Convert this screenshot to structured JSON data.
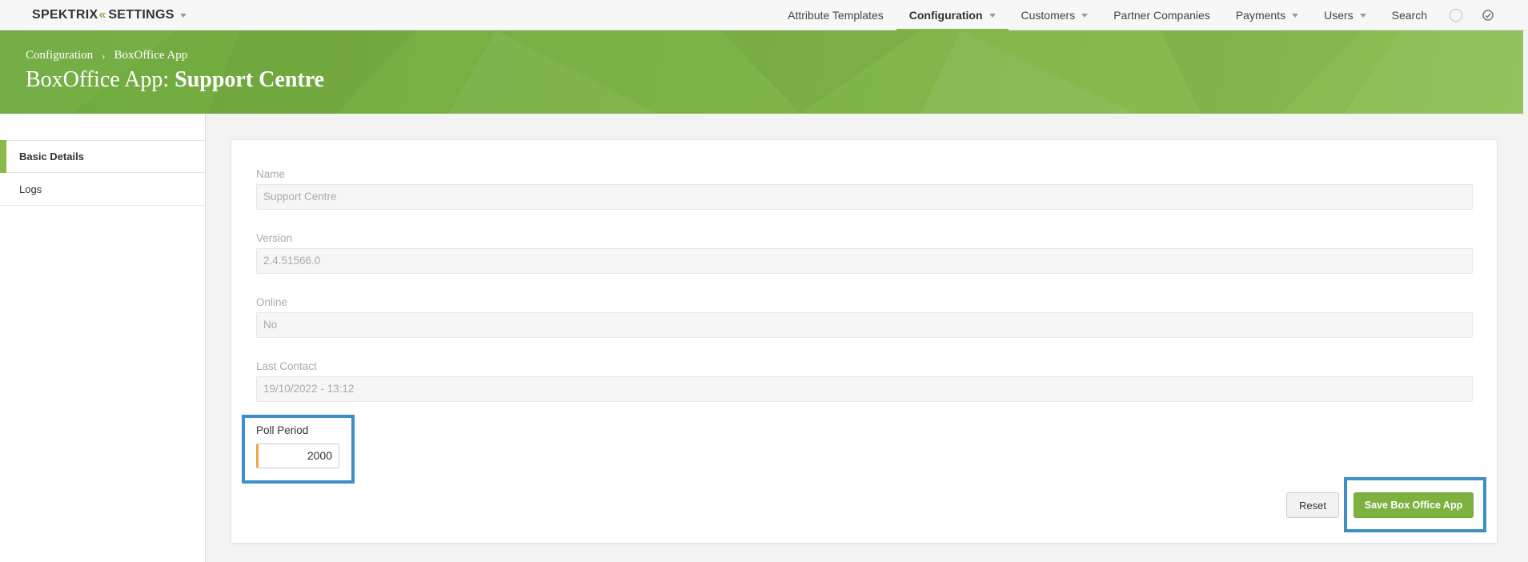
{
  "app": {
    "brand_text": "SPEKTRIX",
    "brand_suffix": "SETTINGS",
    "brand_chevrons": "«"
  },
  "nav": {
    "items": [
      {
        "label": "Attribute Templates",
        "dropdown": false
      },
      {
        "label": "Configuration",
        "dropdown": true,
        "active": true
      },
      {
        "label": "Customers",
        "dropdown": true
      },
      {
        "label": "Partner Companies",
        "dropdown": false
      },
      {
        "label": "Payments",
        "dropdown": true
      },
      {
        "label": "Users",
        "dropdown": true
      },
      {
        "label": "Search",
        "dropdown": false
      }
    ],
    "icons": [
      "status-circle-icon",
      "refresh-icon"
    ]
  },
  "banner": {
    "breadcrumb": [
      "Configuration",
      "BoxOffice App"
    ],
    "breadcrumb_separator": "›",
    "title_prefix": "BoxOffice App: ",
    "title_name": "Support Centre",
    "color": "#7cb346"
  },
  "sidebar": {
    "items": [
      {
        "label": "Basic Details",
        "active": true
      },
      {
        "label": "Logs",
        "active": false
      }
    ]
  },
  "form": {
    "fields": [
      {
        "label": "Name",
        "value": "Support Centre"
      },
      {
        "label": "Version",
        "value": "2.4.51566.0"
      },
      {
        "label": "Online",
        "value": "No"
      },
      {
        "label": "Last Contact",
        "value": "19/10/2022 - 13:12"
      }
    ],
    "poll_period": {
      "label": "Poll Period",
      "value": "2000"
    },
    "reset_label": "Reset",
    "save_label": "Save Box Office App"
  },
  "colors": {
    "accent": "#8ab84a",
    "save_button": "#7eb240",
    "highlight": "#3d8fc5",
    "poll_input_marker": "#f0a347"
  }
}
